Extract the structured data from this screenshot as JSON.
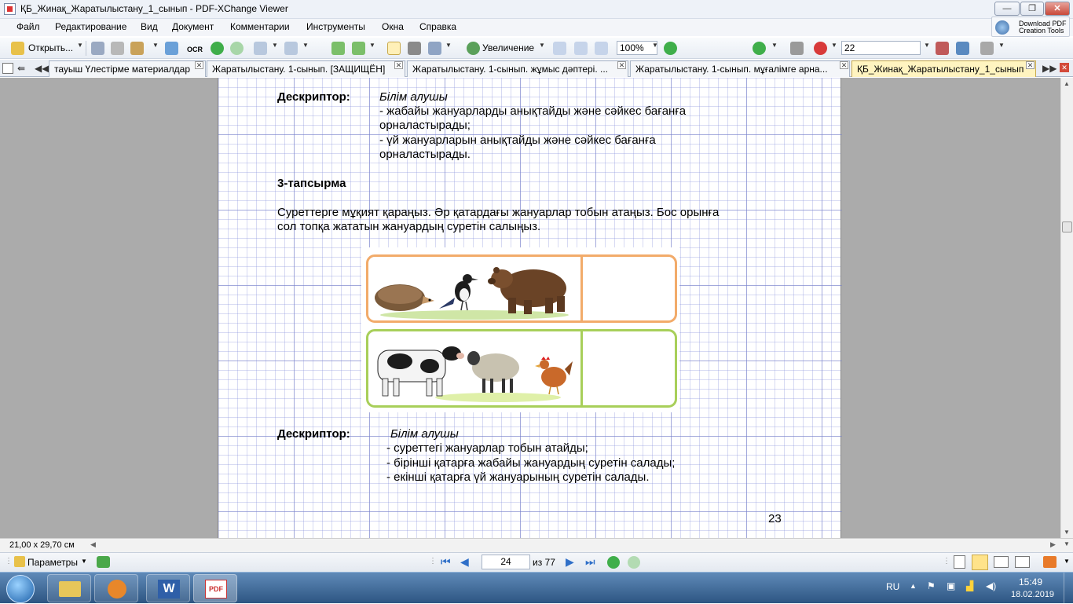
{
  "window": {
    "title": "ҚБ_Жинақ_Жаратылыстану_1_сынып - PDF-XChange Viewer",
    "download_promo": [
      "Download PDF",
      "Creation Tools"
    ]
  },
  "menu": [
    "Файл",
    "Редактирование",
    "Вид",
    "Документ",
    "Комментарии",
    "Инструменты",
    "Окна",
    "Справка"
  ],
  "toolbar": {
    "open_label": "Открыть...",
    "ocr_label": "OCR",
    "zoom_label": "Увеличение",
    "zoom_value": "100%",
    "font_size_value": "22"
  },
  "tabs": [
    {
      "label": "тауыш Үлестірме материалдар",
      "active": false
    },
    {
      "label": "Жаратылыстану. 1-сынып. [ЗАЩИЩЁН]",
      "active": false
    },
    {
      "label": "Жаратылыстану. 1-сынып. жұмыс дәптері. ...",
      "active": false
    },
    {
      "label": "Жаратылыстану. 1-сынып. мұғалімге арна...",
      "active": false
    },
    {
      "label": "ҚБ_Жинақ_Жаратылыстану_1_сынып",
      "active": true
    }
  ],
  "document": {
    "descriptor1_label": "Дескриптор:",
    "descriptor1_lines": [
      "Білім алушы",
      "- жабайы жануарларды анықтайды және сәйкес бағанға",
      "орналастырады;",
      "- үй жануарларын анықтайды және сәйкес бағанға",
      "орналастырады."
    ],
    "task_title": "3-тапсырма",
    "task_text": [
      "Суреттерге  мұқият қараңыз.  Әр қатардағы жануарлар тобын атаңыз.  Бос орынға",
      "сол топқа жататын жануардың суретін салыңыз."
    ],
    "descriptor2_label": "Дескриптор:",
    "descriptor2_lines": [
      "Білім алушы",
      "- суреттегі жануарлар тобын атайды;",
      "- бірінші қатарға жабайы жануардың суретін салады;",
      "- екінші қатарға үй жануарының суретін салады."
    ],
    "page_number_printed": "23",
    "row1_animals": [
      "hedgehog",
      "magpie",
      "bear"
    ],
    "row2_animals": [
      "cow",
      "sheep",
      "hen"
    ],
    "colors": {
      "row1_border": "#f2ab6a",
      "row2_border": "#a8cf5a"
    }
  },
  "status": {
    "page_size": "21,00 x 29,70 см",
    "params_label": "Параметры",
    "current_page": "24",
    "total_pages": "из 77"
  },
  "taskbar": {
    "lang": "RU",
    "time": "15:49",
    "date": "18.02.2019"
  }
}
